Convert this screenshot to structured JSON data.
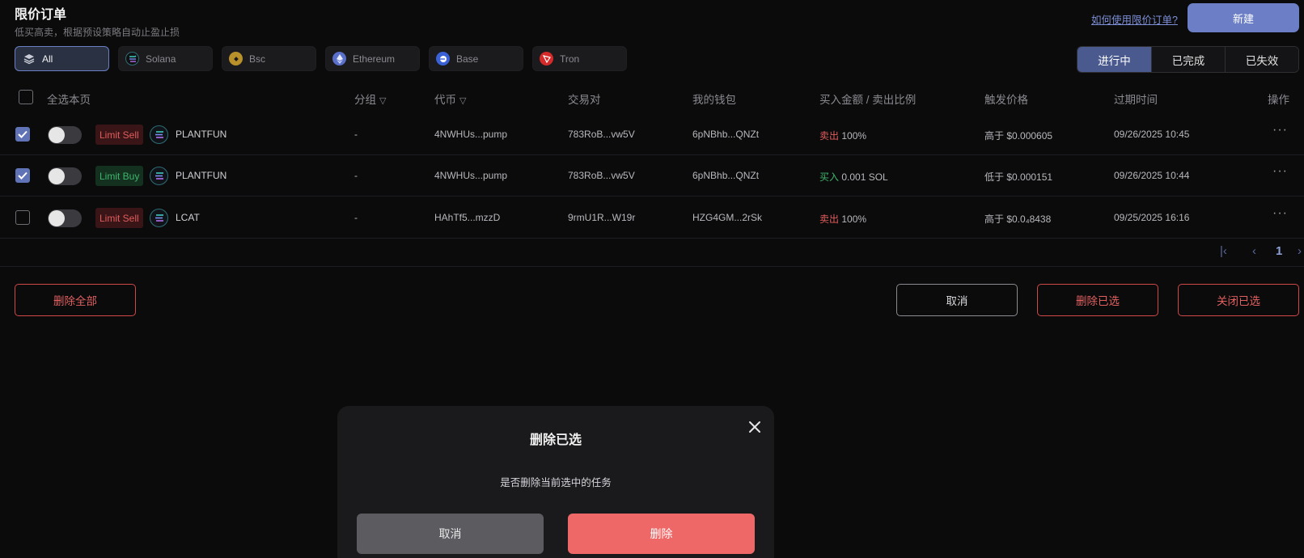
{
  "header": {
    "title": "限价订单",
    "subtitle": "低买高卖，根据预设策略自动止盈止损",
    "howto_link": "如何使用限价订单?",
    "new_button": "新建"
  },
  "chains": [
    {
      "label": "All",
      "icon": "layers-icon",
      "color": "#c9ccd6"
    },
    {
      "label": "Solana",
      "icon": "solana-icon",
      "color": "#2c2c30"
    },
    {
      "label": "Bsc",
      "icon": "bnb-icon",
      "color": "#b8912b"
    },
    {
      "label": "Ethereum",
      "icon": "ethereum-icon",
      "color": "#5a6fc9"
    },
    {
      "label": "Base",
      "icon": "base-icon",
      "color": "#3a62d6"
    },
    {
      "label": "Tron",
      "icon": "tron-icon",
      "color": "#d42a2a"
    }
  ],
  "status_tabs": [
    "进行中",
    "已完成",
    "已失效"
  ],
  "columns": {
    "select_all": "全选本页",
    "group": "分组",
    "token": "代币",
    "pair": "交易对",
    "wallet": "我的钱包",
    "amount": "买入金额 / 卖出比例",
    "trigger": "触发价格",
    "expiry": "过期时间",
    "actions": "操作"
  },
  "rows": [
    {
      "checked": true,
      "type": "Limit Sell",
      "side": "sell",
      "token": "PLANTFUN",
      "group": "-",
      "token_addr": "4NWHUs...pump",
      "pair": "783RoB...vw5V",
      "wallet": "6pNBhb...QNZt",
      "amount_word": "卖出",
      "amount_value": "100%",
      "trigger": "高于 $0.000605",
      "expiry": "09/26/2025 10:45"
    },
    {
      "checked": true,
      "type": "Limit Buy",
      "side": "buy",
      "token": "PLANTFUN",
      "group": "-",
      "token_addr": "4NWHUs...pump",
      "pair": "783RoB...vw5V",
      "wallet": "6pNBhb...QNZt",
      "amount_word": "买入",
      "amount_value": "0.001 SOL",
      "trigger": "低于 $0.000151",
      "expiry": "09/26/2025 10:44"
    },
    {
      "checked": false,
      "type": "Limit Sell",
      "side": "sell",
      "token": "LCAT",
      "group": "-",
      "token_addr": "HAhTf5...mzzD",
      "pair": "9rmU1R...W19r",
      "wallet": "HZG4GM...2rSk",
      "amount_word": "卖出",
      "amount_value": "100%",
      "trigger": "高于 $0.0₄8438",
      "expiry": "09/25/2025 16:16"
    }
  ],
  "pagination": {
    "current_page": "1"
  },
  "actions": {
    "delete_all": "删除全部",
    "cancel": "取消",
    "delete_selected": "删除已选",
    "close_selected": "关闭已选"
  },
  "modal": {
    "title": "删除已选",
    "message": "是否删除当前选中的任务",
    "cancel": "取消",
    "confirm": "删除"
  }
}
